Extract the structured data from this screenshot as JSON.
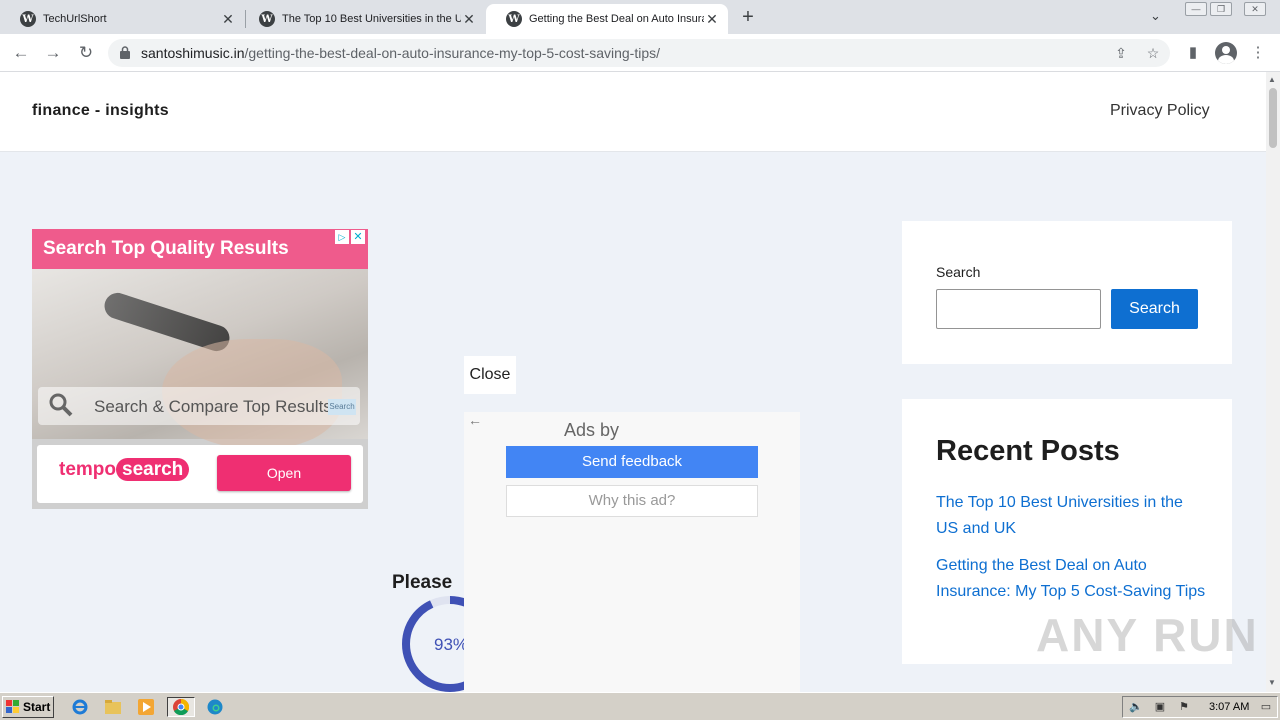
{
  "browser": {
    "tabs": [
      {
        "label": "TechUrlShort",
        "active": false
      },
      {
        "label": "The Top 10 Best Universities in the U",
        "active": false
      },
      {
        "label": "Getting the Best Deal on Auto Insura",
        "active": true
      }
    ],
    "url_host": "santoshimusic.in",
    "url_path": "/getting-the-best-deal-on-auto-insurance-my-top-5-cost-saving-tips/"
  },
  "site": {
    "title": "finance - insights",
    "nav": {
      "privacy": "Privacy Policy"
    }
  },
  "ad": {
    "headline": "Search Top Quality Results",
    "bar_text": "Search & Compare Top Results",
    "bar_button": "Search",
    "brand_left": "tempo",
    "brand_right": "search",
    "open_label": "Open",
    "close_glyph": "✕"
  },
  "overlay": {
    "close_label": "Close",
    "ads_by": "Ads by",
    "send_feedback": "Send feedback",
    "why_this_ad": "Why this ad?"
  },
  "loader": {
    "label": "Please",
    "percent_text": "93%",
    "progress": 0.93
  },
  "sidebar": {
    "search_label": "Search",
    "search_placeholder": "",
    "search_button": "Search",
    "recent_title": "Recent Posts",
    "recent_posts": [
      "The Top 10 Best Universities in the US and UK",
      "Getting the Best Deal on Auto Insurance: My Top 5 Cost-Saving Tips"
    ]
  },
  "watermark": "ANY RUN",
  "taskbar": {
    "start_label": "Start",
    "clock": "3:07 AM"
  },
  "colors": {
    "link": "#0e6fd1",
    "ad_pink": "#ef5b8c",
    "feedback_blue": "#4285f4",
    "progress": "#3f51b5"
  }
}
